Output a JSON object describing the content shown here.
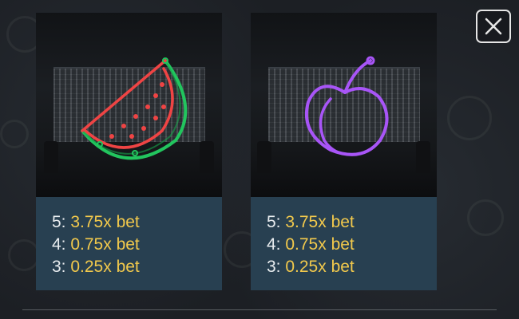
{
  "paytable": {
    "symbols": [
      {
        "icon": "watermelon-icon",
        "color": "#22c55e",
        "payouts": [
          {
            "count": "5:",
            "value": "3.75x bet"
          },
          {
            "count": "4:",
            "value": "0.75x bet"
          },
          {
            "count": "3:",
            "value": "0.25x bet"
          }
        ]
      },
      {
        "icon": "plum-icon",
        "color": "#a855f7",
        "payouts": [
          {
            "count": "5:",
            "value": "3.75x bet"
          },
          {
            "count": "4:",
            "value": "0.75x bet"
          },
          {
            "count": "3:",
            "value": "0.25x bet"
          }
        ]
      }
    ]
  },
  "close_button": {
    "icon": "close-icon"
  },
  "colors": {
    "payout_value": "#f2c94c",
    "payout_count": "#e8ecef",
    "panel": "#284051"
  }
}
